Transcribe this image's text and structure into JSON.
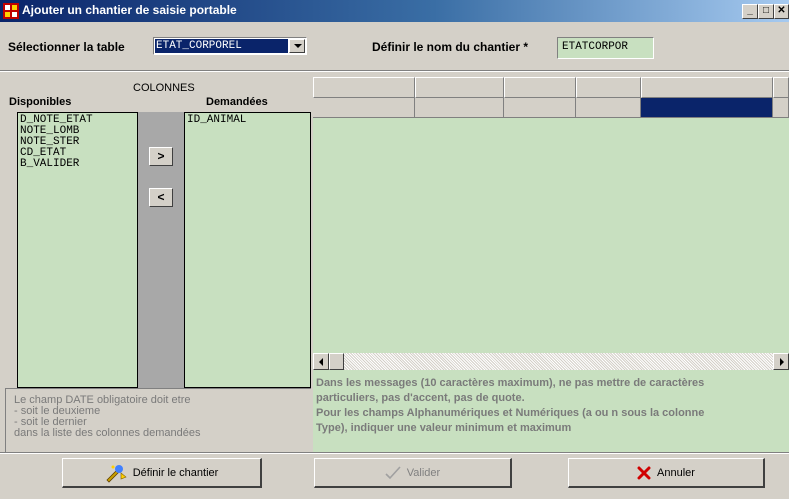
{
  "window": {
    "title": "Ajouter un chantier de saisie portable"
  },
  "toolbar": {
    "select_table_label": "Sélectionner la table",
    "table_value": "ETAT_CORPOREL",
    "name_label": "Définir le nom du chantier *",
    "name_value": "ETATCORPOR"
  },
  "columns": {
    "header": "COLONNES",
    "available_label": "Disponibles",
    "requested_label": "Demandées",
    "available": [
      "D_NOTE_ETAT",
      "NOTE_LOMB",
      "NOTE_STER",
      "CD_ETAT",
      "B_VALIDER"
    ],
    "requested": [
      "ID_ANIMAL"
    ],
    "add_label": ">",
    "remove_label": "<"
  },
  "note": {
    "lines": [
      "Le champ DATE obligatoire doit etre",
      "- soit le deuxieme",
      "- soit le dernier",
      "dans la liste des colonnes demandées"
    ]
  },
  "info": {
    "lines": [
      "Dans les messages (10 caractères maximum), ne pas mettre de caractères",
      "particuliers, pas d'accent, pas de quote.",
      "Pour les champs Alphanumériques et Numériques (a ou n sous la colonne",
      "Type), indiquer une valeur minimum et maximum"
    ]
  },
  "buttons": {
    "define": "Définir le chantier",
    "validate": "Valider",
    "cancel": "Annuler"
  },
  "colors": {
    "panel_green": "#c8e0c0",
    "selection_blue": "#0a246a",
    "chrome_gray": "#d4d0c8"
  }
}
